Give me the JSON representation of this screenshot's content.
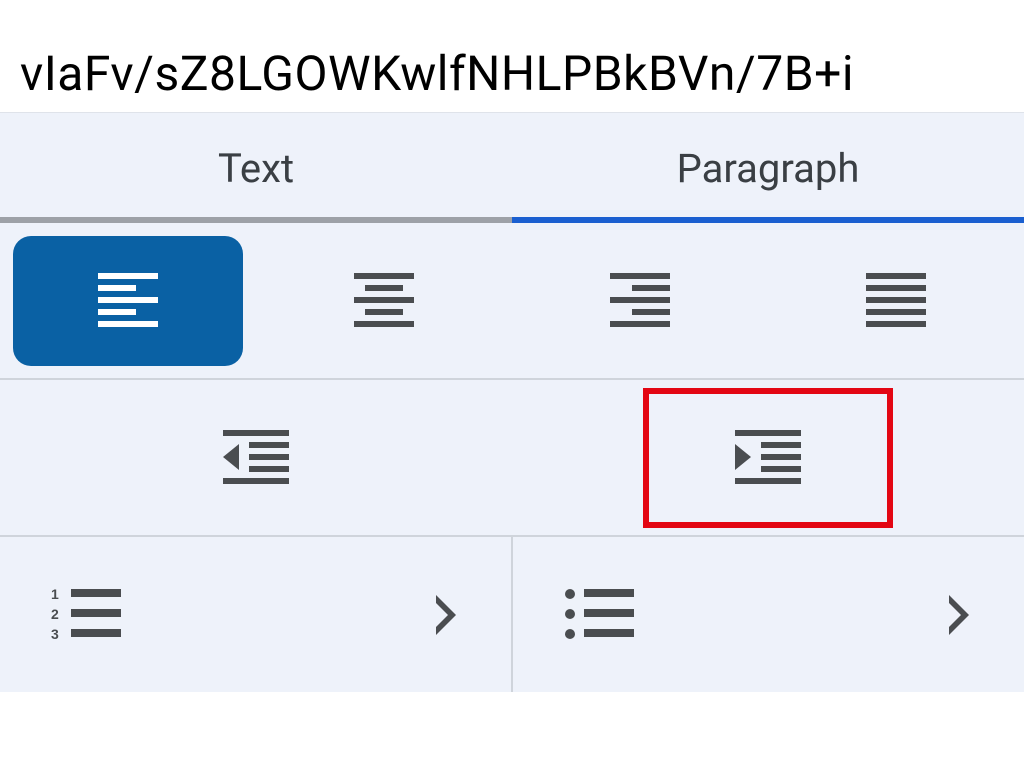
{
  "header_text": "vIaFv/sZ8LGOWKwlfNHLPBkBVn/7B+i",
  "tabs": {
    "text": "Text",
    "paragraph": "Paragraph",
    "active": "paragraph"
  },
  "align": {
    "left": "align-left",
    "center": "align-center",
    "right": "align-right",
    "justify": "align-justify",
    "selected": "left"
  },
  "indent": {
    "decrease": "decrease-indent",
    "increase": "increase-indent"
  },
  "lists": {
    "numbered": "numbered-list",
    "bulleted": "bulleted-list"
  },
  "highlight": "increase-indent"
}
